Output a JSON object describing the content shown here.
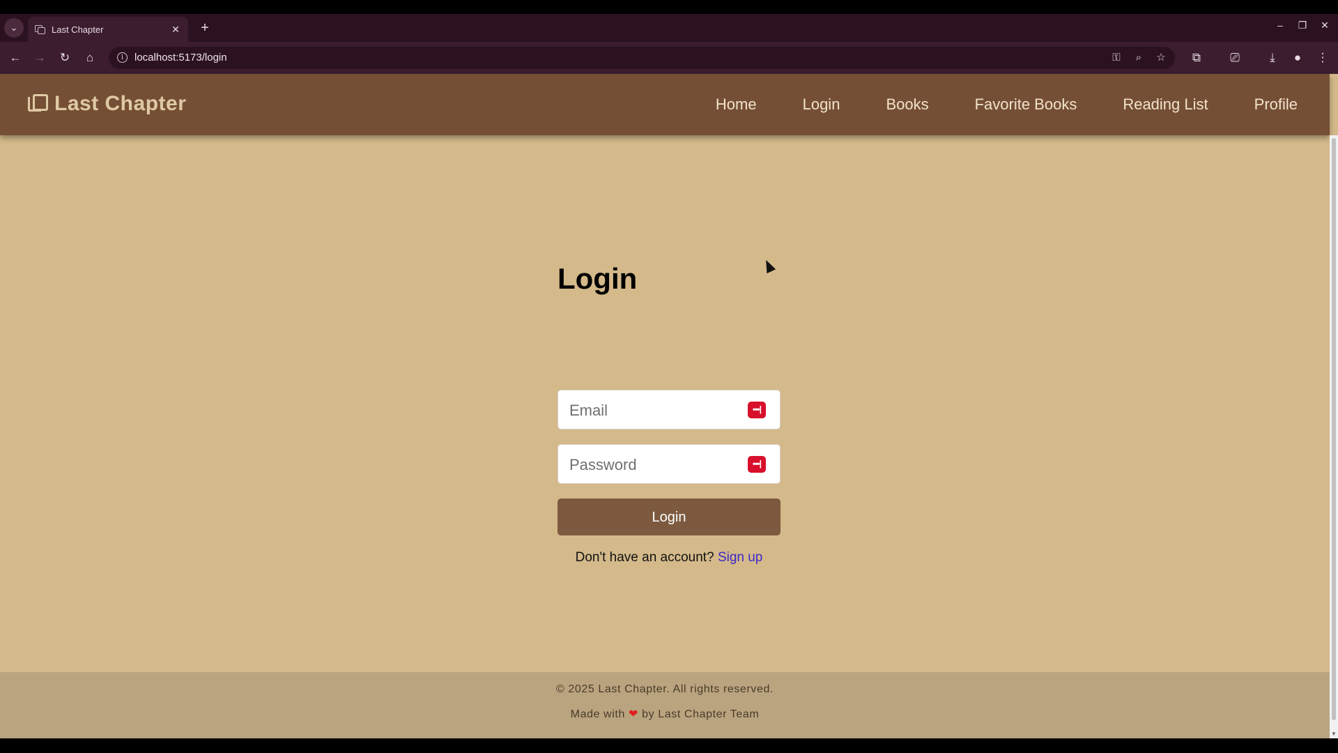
{
  "browser": {
    "tab_title": "Last Chapter",
    "tab_close": "✕",
    "new_tab": "+",
    "url": "localhost:5173/login",
    "controls": {
      "minimize": "–",
      "restore": "❐",
      "close": "✕"
    }
  },
  "navbar": {
    "brand": "Last Chapter",
    "links": [
      "Home",
      "Login",
      "Books",
      "Favorite Books",
      "Reading List",
      "Profile"
    ]
  },
  "login": {
    "title": "Login",
    "email_placeholder": "Email",
    "password_placeholder": "Password",
    "button_label": "Login",
    "signup_prompt": "Don't have an account?",
    "signup_link": "Sign up"
  },
  "footer": {
    "copyright": "© 2025 Last Chapter. All rights reserved.",
    "made_with_prefix": "Made with",
    "heart": "❤",
    "made_with_suffix": "by Last Chapter Team"
  },
  "colors": {
    "navbar": "#754f35",
    "page_bg": "#d4b98a",
    "button": "#7d5a3f",
    "footer": "#b9a47f",
    "link": "#3b28c8"
  },
  "icons": [
    "tab-list-icon",
    "book-stack-icon",
    "back-icon",
    "forward-icon",
    "reload-icon",
    "home-icon",
    "site-info-icon",
    "password-key-icon",
    "zoom-icon",
    "bookmark-star-icon",
    "extensions-icon",
    "cast-icon",
    "download-icon",
    "profile-avatar-icon",
    "menu-icon",
    "password-manager-icon"
  ]
}
